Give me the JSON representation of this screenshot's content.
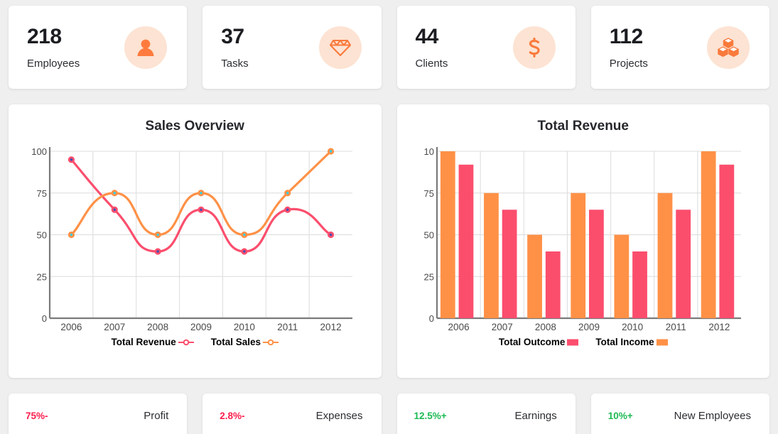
{
  "stats": [
    {
      "value": "218",
      "label": "Employees",
      "icon": "person-icon"
    },
    {
      "value": "37",
      "label": "Tasks",
      "icon": "gem-icon"
    },
    {
      "value": "44",
      "label": "Clients",
      "icon": "dollar-icon"
    },
    {
      "value": "112",
      "label": "Projects",
      "icon": "cubes-icon"
    }
  ],
  "colors": {
    "orange": "#ff9147",
    "pink": "#fb4e6d",
    "green": "#1db954",
    "icon_bg": "#fde3d3",
    "grid": "#dcdcdc",
    "axis": "#7a7a7a",
    "axis_label": "#4a4a4a"
  },
  "metrics": [
    {
      "value": "75%-",
      "label": "Profit",
      "color": "#fb1e4d"
    },
    {
      "value": "2.8%-",
      "label": "Expenses",
      "color": "#fb1e4d"
    },
    {
      "value": "12.5%+",
      "label": "Earnings",
      "color": "#1db954"
    },
    {
      "value": "10%+",
      "label": "New Employees",
      "color": "#1db954"
    }
  ],
  "chart_data": [
    {
      "type": "line",
      "title": "Sales Overview",
      "xlabel": "",
      "ylabel": "",
      "categories": [
        "2006",
        "2007",
        "2008",
        "2009",
        "2010",
        "2011",
        "2012"
      ],
      "yticks": [
        0,
        25,
        50,
        75,
        100
      ],
      "ylim": [
        0,
        100
      ],
      "grid": true,
      "legend_position": "bottom",
      "series": [
        {
          "name": "Total Revenue",
          "color": "#fb4e6d",
          "marker_dot": "#3f4db5",
          "values": [
            95,
            65,
            40,
            65,
            40,
            65,
            50
          ]
        },
        {
          "name": "Total Sales",
          "color": "#ff9147",
          "marker_dot": "#2fd0e8",
          "values": [
            50,
            75,
            50,
            75,
            50,
            75,
            100
          ]
        }
      ]
    },
    {
      "type": "bar",
      "title": "Total Revenue",
      "xlabel": "",
      "ylabel": "",
      "categories": [
        "2006",
        "2007",
        "2008",
        "2009",
        "2010",
        "2011",
        "2012"
      ],
      "yticks": [
        0,
        25,
        50,
        75,
        100
      ],
      "ytick_labels": [
        "0",
        "25",
        "50",
        "75",
        "10"
      ],
      "ylim": [
        0,
        100
      ],
      "grid": true,
      "legend_position": "bottom",
      "series": [
        {
          "name": "Total Income",
          "color": "#ff9147",
          "values": [
            100,
            75,
            50,
            75,
            50,
            75,
            100
          ]
        },
        {
          "name": "Total Outcome",
          "color": "#fb4e6d",
          "values": [
            92,
            65,
            40,
            65,
            40,
            65,
            92
          ]
        }
      ],
      "legend_order": [
        "Total Outcome",
        "Total Income"
      ]
    }
  ]
}
